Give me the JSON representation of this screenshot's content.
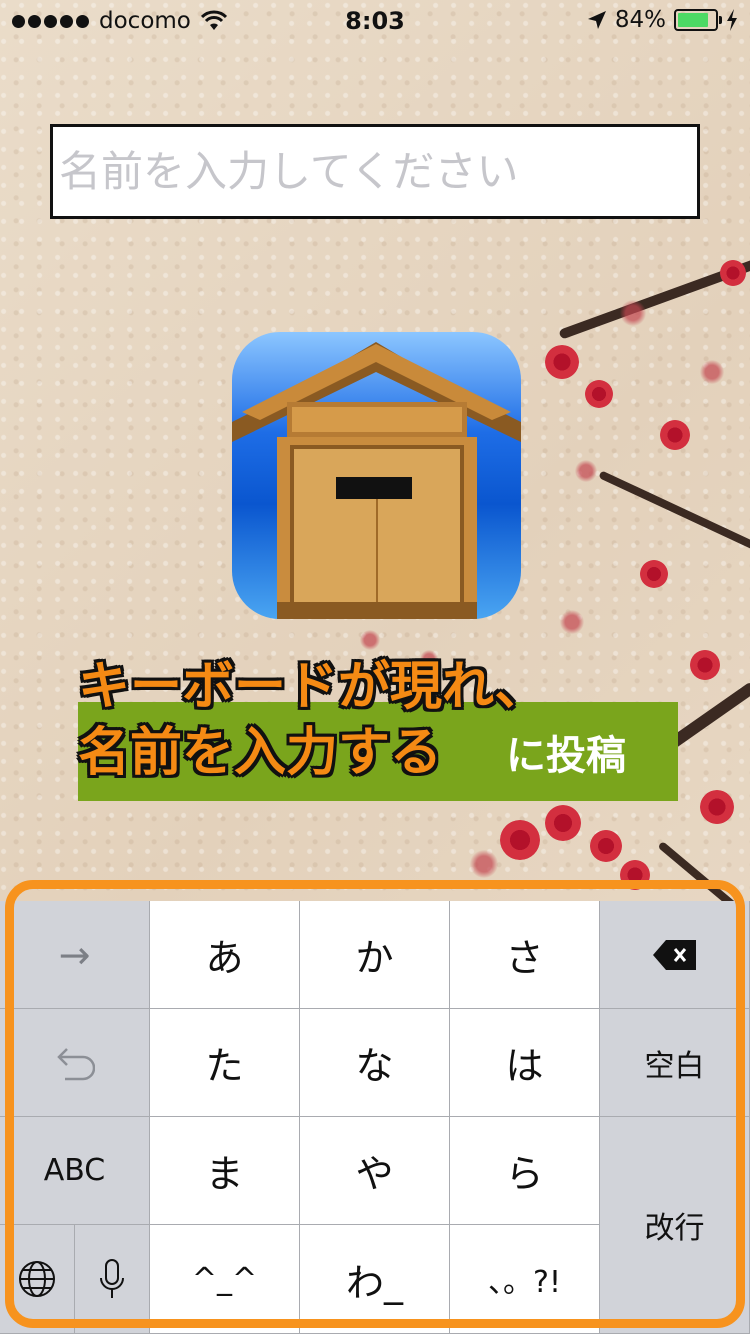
{
  "status_bar": {
    "carrier": "docomo",
    "time": "8:03",
    "battery_percent": "84%",
    "battery_level": 0.84,
    "battery_color": "#4cd964"
  },
  "name_input": {
    "placeholder": "名前を入力してください",
    "value": ""
  },
  "app_icon": {
    "name": "mailbox-icon"
  },
  "post_button": {
    "label": "に投稿",
    "color": "#7aa51c"
  },
  "callout": {
    "text": "キーボードが現れ、\n名前を入力する",
    "color": "#f58a14"
  },
  "keyboard": {
    "highlight_color": "#f7931e",
    "rows": [
      {
        "left": "→",
        "keys": [
          "あ",
          "か",
          "さ"
        ],
        "right": "delete-icon"
      },
      {
        "left": "undo-icon",
        "keys": [
          "た",
          "な",
          "は"
        ],
        "right": "空白"
      },
      {
        "left": "ABC",
        "keys": [
          "ま",
          "や",
          "ら"
        ],
        "right": "改行"
      },
      {
        "left": [
          "globe-icon",
          "microphone-icon"
        ],
        "keys": [
          "^_^",
          "わ_",
          "、。?!"
        ]
      }
    ],
    "next_key": "→",
    "abc_key": "ABC",
    "space_key": "空白",
    "return_key": "改行",
    "k1": "あ",
    "k2": "か",
    "k3": "さ",
    "k4": "た",
    "k5": "な",
    "k6": "は",
    "k7": "ま",
    "k8": "や",
    "k9": "ら",
    "k10": "^_^",
    "k11": "わ_",
    "k12": "、。?!"
  }
}
